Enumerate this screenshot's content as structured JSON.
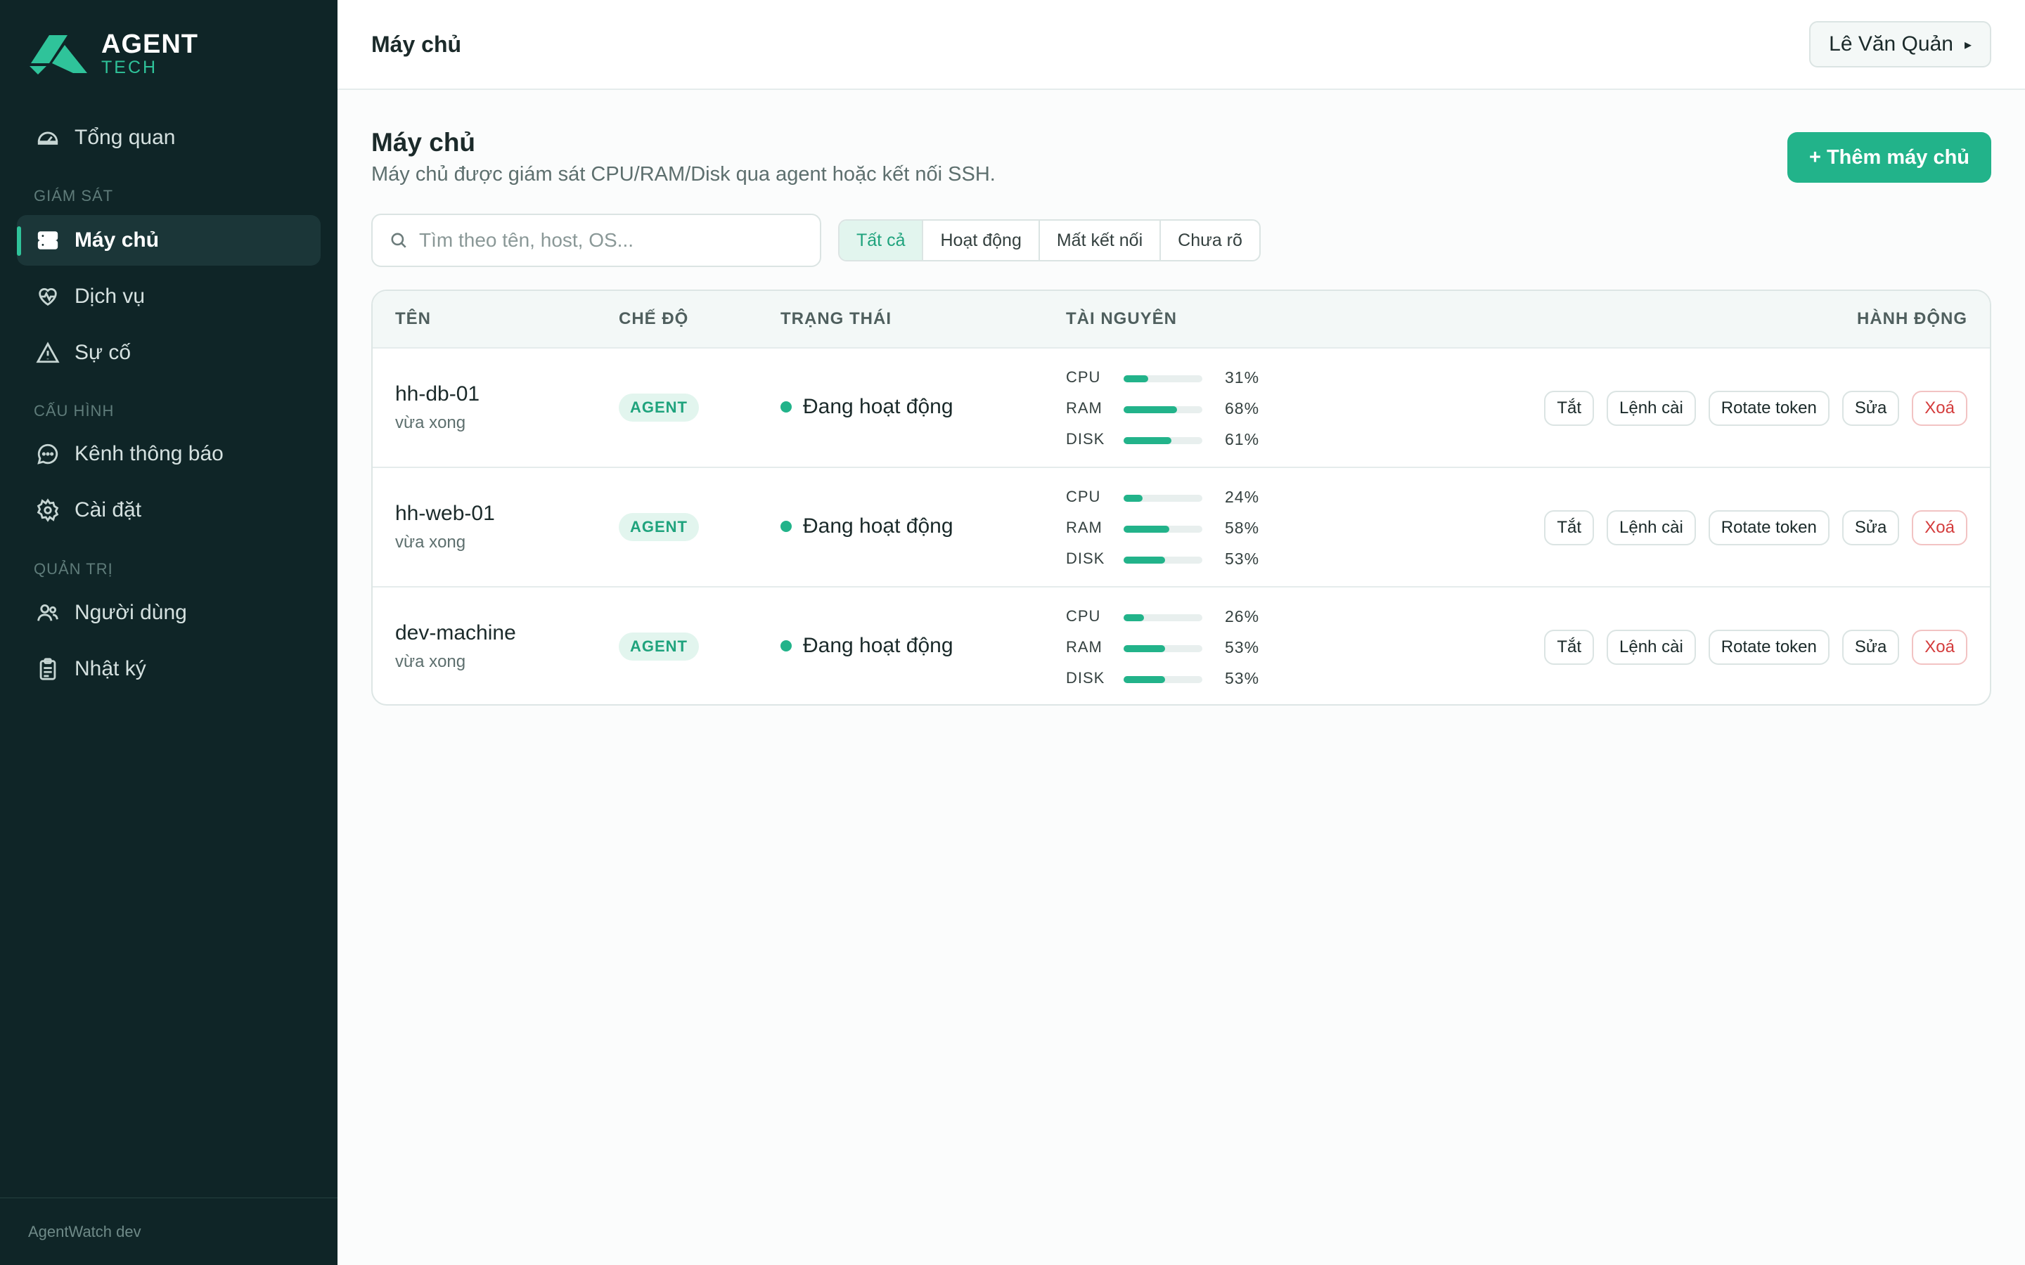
{
  "brand": {
    "line1": "AGENT",
    "line2": "TECH"
  },
  "sidebar": {
    "overview": "Tổng quan",
    "section_monitor": "GIÁM SÁT",
    "servers": "Máy chủ",
    "services": "Dịch vụ",
    "incidents": "Sự cố",
    "section_config": "CẤU HÌNH",
    "channels": "Kênh thông báo",
    "settings": "Cài đặt",
    "section_admin": "QUẢN TRỊ",
    "users": "Người dùng",
    "logs": "Nhật ký",
    "footer": "AgentWatch dev"
  },
  "topbar": {
    "title": "Máy chủ",
    "user": "Lê Văn Quản",
    "caret": "▸"
  },
  "page": {
    "title": "Máy chủ",
    "subtitle": "Máy chủ được giám sát CPU/RAM/Disk qua agent hoặc kết nối SSH.",
    "add_label": "+ Thêm máy chủ"
  },
  "search": {
    "placeholder": "Tìm theo tên, host, OS..."
  },
  "filters": [
    "Tất cả",
    "Hoạt động",
    "Mất kết nối",
    "Chưa rõ"
  ],
  "columns": {
    "name": "TÊN",
    "mode": "CHẾ ĐỘ",
    "status": "TRẠNG THÁI",
    "resources": "TÀI NGUYÊN",
    "actions": "HÀNH ĐỘNG"
  },
  "resource_labels": [
    "CPU",
    "RAM",
    "DISK"
  ],
  "action_labels": {
    "off": "Tắt",
    "install": "Lệnh cài",
    "rotate": "Rotate token",
    "edit": "Sửa",
    "delete": "Xoá"
  },
  "rows": [
    {
      "name": "hh-db-01",
      "time": "vừa xong",
      "mode": "AGENT",
      "status": "Đang hoạt động",
      "cpu": "31%",
      "ram": "68%",
      "disk": "61%",
      "cpu_v": 31,
      "ram_v": 68,
      "disk_v": 61
    },
    {
      "name": "hh-web-01",
      "time": "vừa xong",
      "mode": "AGENT",
      "status": "Đang hoạt động",
      "cpu": "24%",
      "ram": "58%",
      "disk": "53%",
      "cpu_v": 24,
      "ram_v": 58,
      "disk_v": 53
    },
    {
      "name": "dev-machine",
      "time": "vừa xong",
      "mode": "AGENT",
      "status": "Đang hoạt động",
      "cpu": "26%",
      "ram": "53%",
      "disk": "53%",
      "cpu_v": 26,
      "ram_v": 53,
      "disk_v": 53
    }
  ],
  "colors": {
    "accent": "#22b38a",
    "sidebar_bg": "#0f2527",
    "danger": "#d43c3c"
  }
}
